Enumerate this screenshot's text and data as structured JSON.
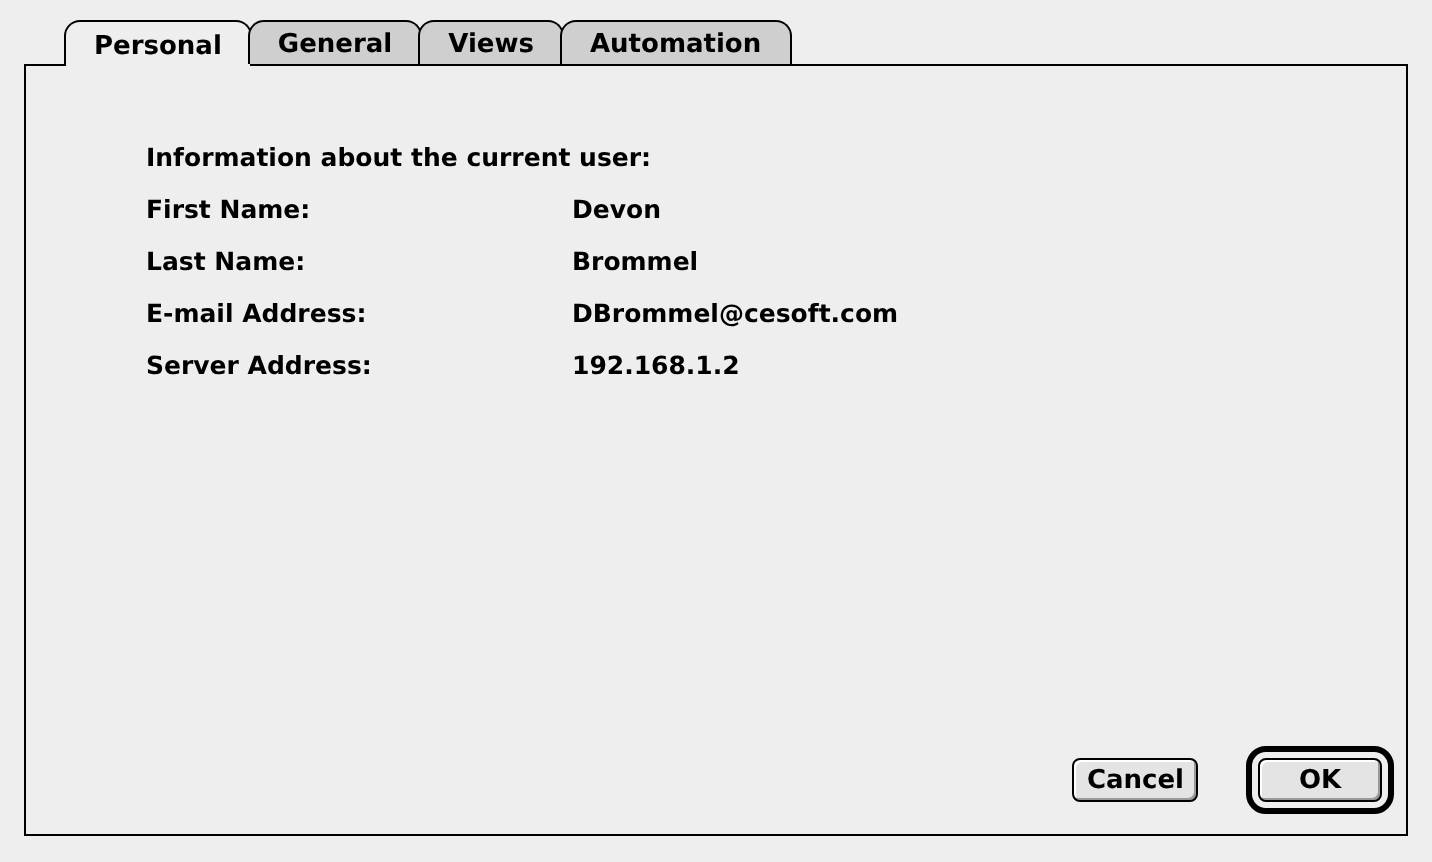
{
  "tabs": [
    {
      "label": "Personal",
      "selected": true
    },
    {
      "label": "General",
      "selected": false
    },
    {
      "label": "Views",
      "selected": false
    },
    {
      "label": "Automation",
      "selected": false
    }
  ],
  "heading": "Information about the current user:",
  "fields": [
    {
      "label": "First Name:",
      "value": "Devon"
    },
    {
      "label": "Last Name:",
      "value": "Brommel"
    },
    {
      "label": "E-mail Address:",
      "value": "DBrommel@cesoft.com"
    },
    {
      "label": "Server Address:",
      "value": "192.168.1.2"
    }
  ],
  "buttons": [
    {
      "label": "Cancel",
      "kind": "normal"
    },
    {
      "label": "OK",
      "kind": "default"
    }
  ]
}
